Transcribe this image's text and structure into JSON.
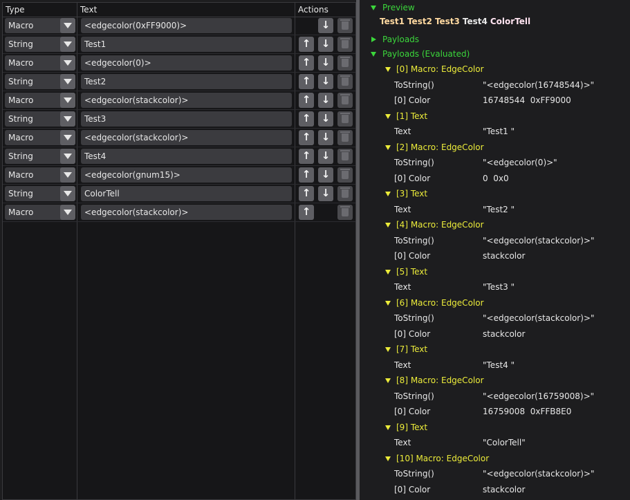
{
  "table": {
    "headers": {
      "type": "Type",
      "text": "Text",
      "actions": "Actions"
    },
    "rows": [
      {
        "type": "Macro",
        "text": "<edgecolor(0xFF9000)>",
        "up": false,
        "down": true,
        "del": true
      },
      {
        "type": "String",
        "text": "Test1",
        "up": true,
        "down": true,
        "del": true
      },
      {
        "type": "Macro",
        "text": "<edgecolor(0)>",
        "up": true,
        "down": true,
        "del": true
      },
      {
        "type": "String",
        "text": "Test2",
        "up": true,
        "down": true,
        "del": true
      },
      {
        "type": "Macro",
        "text": "<edgecolor(stackcolor)>",
        "up": true,
        "down": true,
        "del": true
      },
      {
        "type": "String",
        "text": "Test3",
        "up": true,
        "down": true,
        "del": true
      },
      {
        "type": "Macro",
        "text": "<edgecolor(stackcolor)>",
        "up": true,
        "down": true,
        "del": true
      },
      {
        "type": "String",
        "text": "Test4",
        "up": true,
        "down": true,
        "del": true
      },
      {
        "type": "Macro",
        "text": "<edgecolor(gnum15)>",
        "up": true,
        "down": true,
        "del": true
      },
      {
        "type": "String",
        "text": "ColorTell",
        "up": true,
        "down": true,
        "del": true
      },
      {
        "type": "Macro",
        "text": "<edgecolor(stackcolor)>",
        "up": true,
        "down": false,
        "del": true
      }
    ],
    "icons": {
      "up": "arrow-up-icon",
      "down": "arrow-down-icon",
      "delete": "trash-icon",
      "dropdown": "chevron-down-icon"
    }
  },
  "tree": {
    "preview_label": "Preview",
    "preview": [
      {
        "text": "Test1",
        "color": "#ffd9a0"
      },
      {
        "text": "Test2",
        "color": "#ffd9a0"
      },
      {
        "text": "Test3",
        "color": "#ffd9a0"
      },
      {
        "text": "Test4",
        "color": "#e8e8e8"
      },
      {
        "text": "ColorTell",
        "color": "#ffe3f0"
      }
    ],
    "payloads_label": "Payloads",
    "evaluated_label": "Payloads (Evaluated)",
    "items": [
      {
        "title": "[0] Macro: EdgeColor",
        "props": [
          {
            "k": "ToString()",
            "v": "\"<edgecolor(16748544)>\""
          },
          {
            "k": "[0] Color",
            "v": "16748544  0xFF9000"
          }
        ]
      },
      {
        "title": "[1] Text",
        "props": [
          {
            "k": "Text",
            "v": "\"Test1 \""
          }
        ]
      },
      {
        "title": "[2] Macro: EdgeColor",
        "props": [
          {
            "k": "ToString()",
            "v": "\"<edgecolor(0)>\""
          },
          {
            "k": "[0] Color",
            "v": "0  0x0"
          }
        ]
      },
      {
        "title": "[3] Text",
        "props": [
          {
            "k": "Text",
            "v": "\"Test2 \""
          }
        ]
      },
      {
        "title": "[4] Macro: EdgeColor",
        "props": [
          {
            "k": "ToString()",
            "v": "\"<edgecolor(stackcolor)>\""
          },
          {
            "k": "[0] Color",
            "v": "stackcolor"
          }
        ]
      },
      {
        "title": "[5] Text",
        "props": [
          {
            "k": "Text",
            "v": "\"Test3 \""
          }
        ]
      },
      {
        "title": "[6] Macro: EdgeColor",
        "props": [
          {
            "k": "ToString()",
            "v": "\"<edgecolor(stackcolor)>\""
          },
          {
            "k": "[0] Color",
            "v": "stackcolor"
          }
        ]
      },
      {
        "title": "[7] Text",
        "props": [
          {
            "k": "Text",
            "v": "\"Test4 \""
          }
        ]
      },
      {
        "title": "[8] Macro: EdgeColor",
        "props": [
          {
            "k": "ToString()",
            "v": "\"<edgecolor(16759008)>\""
          },
          {
            "k": "[0] Color",
            "v": "16759008  0xFFB8E0"
          }
        ]
      },
      {
        "title": "[9] Text",
        "props": [
          {
            "k": "Text",
            "v": "\"ColorTell\""
          }
        ]
      },
      {
        "title": "[10] Macro: EdgeColor",
        "props": [
          {
            "k": "ToString()",
            "v": "\"<edgecolor(stackcolor)>\""
          },
          {
            "k": "[0] Color",
            "v": "stackcolor"
          }
        ]
      }
    ]
  },
  "colors": {
    "tree_header": "#3bd63b",
    "tree_item": "#ecec3a",
    "panel_bg": "#161618",
    "widget_bg": "#3b3b3f"
  }
}
